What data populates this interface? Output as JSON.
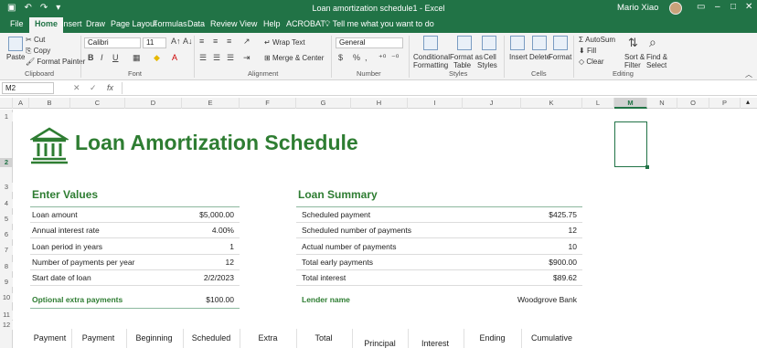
{
  "window": {
    "title": "Loan amortization schedule1  -  Excel",
    "user": "Mario Xiao"
  },
  "menu": {
    "tabs": [
      "File",
      "Home",
      "Insert",
      "Draw",
      "Page Layout",
      "Formulas",
      "Data",
      "Review",
      "View",
      "Help",
      "ACROBAT"
    ],
    "active": "Home",
    "tell_me": "Tell me what you want to do"
  },
  "ribbon": {
    "clipboard": {
      "paste": "Paste",
      "cut": "Cut",
      "copy": "Copy",
      "format_painter": "Format Painter",
      "label": "Clipboard"
    },
    "font": {
      "name": "Calibri",
      "size": "11",
      "bold": "B",
      "italic": "I",
      "underline": "U",
      "label": "Font"
    },
    "alignment": {
      "wrap": "Wrap Text",
      "merge": "Merge & Center",
      "label": "Alignment"
    },
    "number": {
      "format": "General",
      "label": "Number"
    },
    "styles": {
      "conditional": "Conditional",
      "formatting": "Formatting",
      "format_as": "Format as",
      "table": "Table",
      "cell": "Cell",
      "cell_styles": "Styles",
      "label": "Styles"
    },
    "cells": {
      "insert": "Insert",
      "delete": "Delete",
      "format": "Format",
      "label": "Cells"
    },
    "editing": {
      "autosum": "AutoSum",
      "fill": "Fill",
      "clear": "Clear",
      "sort": "Sort &",
      "filter": "Filter",
      "find": "Find &",
      "select": "Select",
      "label": "Editing"
    }
  },
  "formula_bar": {
    "name_box": "M2",
    "fx": "fx",
    "formula": ""
  },
  "columns": [
    "A",
    "B",
    "C",
    "D",
    "E",
    "F",
    "G",
    "H",
    "I",
    "J",
    "K",
    "L",
    "M",
    "N",
    "O",
    "P"
  ],
  "selected_column": "M",
  "rows": [
    "1",
    "2",
    "3",
    "4",
    "5",
    "6",
    "7",
    "8",
    "9",
    "10",
    "11",
    "12"
  ],
  "sheet": {
    "title": "Loan Amortization Schedule",
    "enter_values": {
      "heading": "Enter Values",
      "rows": [
        {
          "label": "Loan amount",
          "value": "$5,000.00"
        },
        {
          "label": "Annual interest rate",
          "value": "4.00%"
        },
        {
          "label": "Loan period in years",
          "value": "1"
        },
        {
          "label": "Number of payments per year",
          "value": "12"
        },
        {
          "label": "Start date of loan",
          "value": "2/2/2023"
        }
      ],
      "extra_label": "Optional extra payments",
      "extra_value": "$100.00"
    },
    "loan_summary": {
      "heading": "Loan Summary",
      "rows": [
        {
          "label": "Scheduled payment",
          "value": "$425.75"
        },
        {
          "label": "Scheduled number of payments",
          "value": "12"
        },
        {
          "label": "Actual number of payments",
          "value": "10"
        },
        {
          "label": "Total early payments",
          "value": "$900.00"
        },
        {
          "label": "Total interest",
          "value": "$89.62"
        }
      ],
      "lender_label": "Lender name",
      "lender_value": "Woodgrove Bank"
    },
    "table_headers": [
      "Payment",
      "Payment",
      "Beginning",
      "Scheduled",
      "Extra",
      "Total",
      "Principal",
      "Interest",
      "Ending",
      "Cumulative"
    ]
  },
  "colors": {
    "excel_green": "#217346",
    "title_green": "#2e7d32"
  }
}
